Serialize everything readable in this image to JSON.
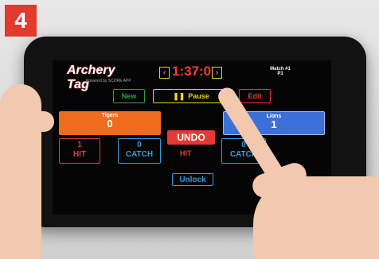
{
  "step_badge": "4",
  "app": {
    "logo_text": "Archery Tag",
    "logo_sub": "Powered by SCORE APP",
    "timer": "1:37:0",
    "timer_prev_icon": "chevron-left-icon",
    "timer_next_icon": "chevron-right-icon",
    "match_label": "Match #1",
    "match_value": "P1"
  },
  "controls": {
    "new_label": "New",
    "pause_label": "Pause",
    "pause_icon": "pause-icon",
    "edit_label": "Edit",
    "undo_label": "UNDO",
    "hit_label": "HIT",
    "unlock_label": "Unlock"
  },
  "teams": {
    "left": {
      "name": "Tigers",
      "score": "0",
      "hit_value": "1",
      "hit_label": "HIT",
      "catch_value": "0",
      "catch_label": "CATCH"
    },
    "right": {
      "name": "Lions",
      "score": "1",
      "catch_value": "0",
      "catch_label": "CATCH"
    }
  },
  "colors": {
    "accent_orange": "#ef6c1c",
    "accent_blue": "#3d6fd8",
    "accent_red": "#e53935",
    "accent_yellow": "#e8d41a",
    "accent_green": "#2ea043"
  }
}
